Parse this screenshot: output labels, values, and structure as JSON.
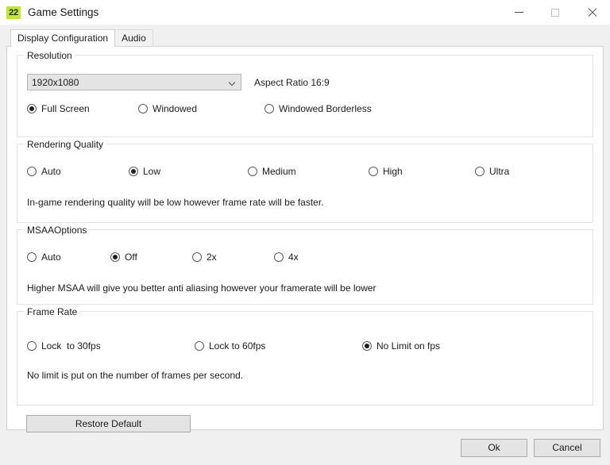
{
  "window": {
    "icon_text": "22",
    "icon_color": "#c3e82b",
    "title": "Game Settings",
    "controls": {
      "minimize": "Minimize",
      "maximize": "Maximize",
      "close": "Close"
    }
  },
  "tabs": [
    {
      "label": "Display Configuration",
      "active": true
    },
    {
      "label": "Audio",
      "active": false
    }
  ],
  "resolution": {
    "legend": "Resolution",
    "selected_resolution": "1920x1080",
    "aspect_ratio_label": "Aspect Ratio 16:9",
    "modes": [
      {
        "label": "Full Screen",
        "checked": true
      },
      {
        "label": "Windowed",
        "checked": false
      },
      {
        "label": "Windowed Borderless",
        "checked": false
      }
    ]
  },
  "rendering_quality": {
    "legend": "Rendering Quality",
    "options": [
      {
        "label": "Auto",
        "checked": false
      },
      {
        "label": "Low",
        "checked": true
      },
      {
        "label": "Medium",
        "checked": false
      },
      {
        "label": "High",
        "checked": false
      },
      {
        "label": "Ultra",
        "checked": false
      }
    ],
    "hint": "In-game rendering quality will be low however frame rate will be faster."
  },
  "msaa": {
    "legend": "MSAAOptions",
    "options": [
      {
        "label": "Auto",
        "checked": false
      },
      {
        "label": "Off",
        "checked": true
      },
      {
        "label": "2x",
        "checked": false
      },
      {
        "label": "4x",
        "checked": false
      }
    ],
    "hint": "Higher MSAA will give you better anti aliasing however your framerate will be lower"
  },
  "frame_rate": {
    "legend": "Frame Rate",
    "options": [
      {
        "label": "Lock  to 30fps",
        "checked": false
      },
      {
        "label": "Lock to 60fps",
        "checked": false
      },
      {
        "label": "No Limit on fps",
        "checked": true
      }
    ],
    "hint": "No limit is put on the number of frames per second."
  },
  "buttons": {
    "restore_default": "Restore Default",
    "ok": "Ok",
    "cancel": "Cancel"
  }
}
